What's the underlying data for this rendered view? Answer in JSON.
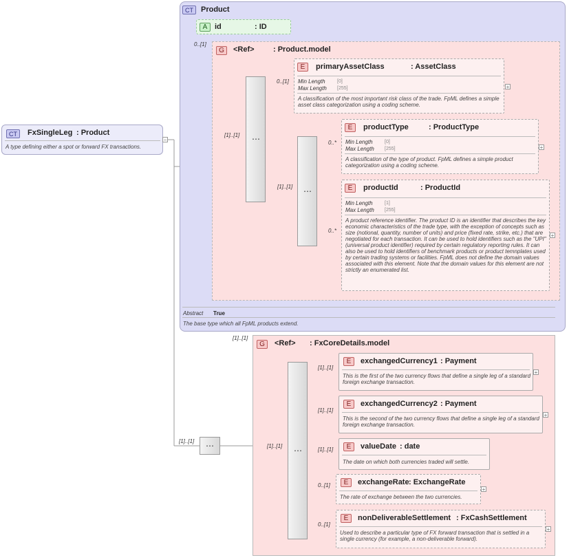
{
  "root": {
    "badge": "CT",
    "name": "FxSingleLeg",
    "type": ": Product",
    "desc": "A type defining either a spot or forward FX transactions.",
    "collapse": "−"
  },
  "product": {
    "badge": "CT",
    "title": "Product",
    "attr": {
      "badge": "A",
      "name": "id",
      "type": ": ID"
    },
    "attr_card": "0..[1]",
    "abstract_label": "Abstract",
    "abstract_value": "True",
    "desc": "The base type which all FpML products extend.",
    "group": {
      "badge": "G",
      "ref": "<Ref>",
      "name": ": Product.model",
      "card": "[1]..[1]"
    }
  },
  "elements": [
    {
      "badge": "E",
      "name": "primaryAssetClass",
      "type": ": AssetClass",
      "card": "0..[1]",
      "min_label": "Min Length",
      "min": "[0]",
      "max_label": "Max Length",
      "max": "[255]",
      "desc": "A classification of the most important risk class of the trade. FpML defines a simple asset class categorization using a coding scheme."
    },
    {
      "badge": "E",
      "name": "productType",
      "type": ": ProductType",
      "card": "0..*",
      "min_label": "Min Length",
      "min": "[0]",
      "max_label": "Max Length",
      "max": "[255]",
      "desc": "A classification of the type of product. FpML defines a simple product categorization using a coding scheme."
    },
    {
      "badge": "E",
      "name": "productId",
      "type": ": ProductId",
      "card": "0..*",
      "min_label": "Min Length",
      "min": "[1]",
      "max_label": "Max Length",
      "max": "[255]",
      "desc": "A product reference identifier. The product ID is an identifier that describes the key economic characteristics of the trade type, with the exception of concepts such as size (notional, quantity, number of units) and price (fixed rate, strike, etc.) that are negotiated for each transaction. It can be used to hold identifiers such as the \"UPI\" (universal product identifier) required by certain regulatory reporting rules. It can also be used to hold identifiers of benchmark products or product temnplates used by certain trading systems or facilities. FpML does not define the domain values associated with this element. Note that the domain values for this element are not strictly an enumerated list."
    }
  ],
  "inner_choice_card": "[1]..[1]",
  "fx_group": {
    "badge": "G",
    "ref": "<Ref>",
    "name": ": FxCoreDetails.model",
    "card": "[1]..[1]",
    "seq_card": "[1]..[1]"
  },
  "fx_elements": [
    {
      "badge": "E",
      "name": "exchangedCurrency1",
      "type": ": Payment",
      "card": "[1]..[1]",
      "desc": "This is the first of the two currency flows that define a single leg of a standard foreign exchange transaction."
    },
    {
      "badge": "E",
      "name": "exchangedCurrency2",
      "type": ": Payment",
      "card": "[1]..[1]",
      "desc": "This is the second of the two currency flows that define a single leg of a standard foreign exchange transaction."
    },
    {
      "badge": "E",
      "name": "valueDate",
      "type": ": date",
      "card": "[1]..[1]",
      "desc": "The date on which both currencies traded will settle."
    },
    {
      "badge": "E",
      "name": "exchangeRate",
      "type": ": ExchangeRate",
      "card": "0..[1]",
      "desc": "The rate of exchange between the two currencies."
    },
    {
      "badge": "E",
      "name": "nonDeliverableSettlement",
      "type": ": FxCashSettlement",
      "card": "0..[1]",
      "desc": "Used to describe a particular type of FX forward transaction that is settled in a single currency (for example, a non-deliverable forward)."
    }
  ],
  "outer_seq_card": "[1]..[1]",
  "expand_symbol": "+",
  "seq_symbol": "⋯"
}
